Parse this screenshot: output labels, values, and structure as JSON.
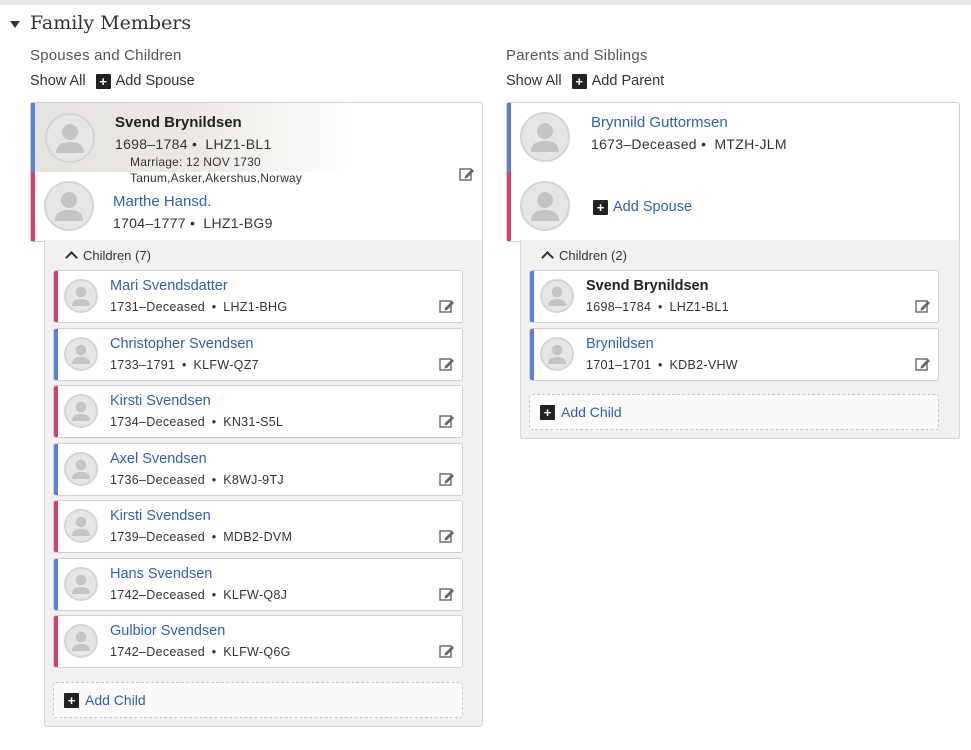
{
  "section": {
    "title": "Family Members"
  },
  "spouses_children": {
    "title": "Spouses and Children",
    "show_all": "Show All",
    "add_spouse": "Add Spouse",
    "husband": {
      "name": "Svend Brynildsen",
      "dates": "1698–1784",
      "id": "LHZ1-BL1"
    },
    "marriage": {
      "label": "Marriage: 12 NOV 1730",
      "place": "Tanum,Asker,Akershus,Norway"
    },
    "wife": {
      "name": "Marthe Hansd.",
      "dates": "1704–1777",
      "id": "LHZ1-BG9"
    },
    "children_label": "Children (7)",
    "children": [
      {
        "name": "Mari Svendsdatter",
        "dates": "1731–Deceased",
        "id": "LHZ1-BHG",
        "sex": "female"
      },
      {
        "name": "Christopher Svendsen",
        "dates": "1733–1791",
        "id": "KLFW-QZ7",
        "sex": "male"
      },
      {
        "name": "Kirsti Svendsen",
        "dates": "1734–Deceased",
        "id": "KN31-S5L",
        "sex": "female"
      },
      {
        "name": "Axel Svendsen",
        "dates": "1736–Deceased",
        "id": "K8WJ-9TJ",
        "sex": "male"
      },
      {
        "name": "Kirsti Svendsen",
        "dates": "1739–Deceased",
        "id": "MDB2-DVM",
        "sex": "female"
      },
      {
        "name": "Hans Svendsen",
        "dates": "1742–Deceased",
        "id": "KLFW-Q8J",
        "sex": "male"
      },
      {
        "name": "Gulbior Svendsen",
        "dates": "1742–Deceased",
        "id": "KLFW-Q6G",
        "sex": "female"
      }
    ],
    "add_child": "Add Child"
  },
  "parents_siblings": {
    "title": "Parents and Siblings",
    "show_all": "Show All",
    "add_parent": "Add Parent",
    "father": {
      "name": "Brynnild Guttormsen",
      "dates": "1673–Deceased",
      "id": "MTZH-JLM"
    },
    "add_spouse": "Add Spouse",
    "children_label": "Children (2)",
    "children": [
      {
        "name": "Svend Brynildsen",
        "dates": "1698–1784",
        "id": "LHZ1-BL1",
        "sex": "male",
        "current": true
      },
      {
        "name": "Brynildsen",
        "dates": "1701–1701",
        "id": "KDB2-VHW",
        "sex": "male"
      }
    ],
    "add_child": "Add Child"
  },
  "colors": {
    "male": "#5b7fd6",
    "female": "#d6406f",
    "link": "#2f62b4"
  },
  "icons": {
    "avatar": "person-silhouette-icon",
    "edit": "edit-icon",
    "add": "plus-square-icon",
    "collapse": "chevron-up-icon",
    "section_toggle": "caret-down-icon"
  }
}
